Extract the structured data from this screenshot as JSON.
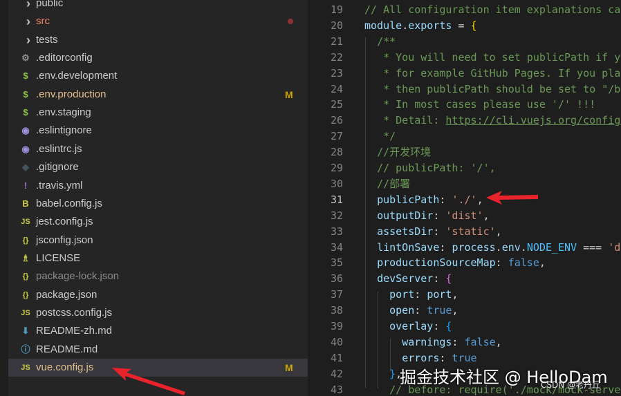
{
  "explorer": {
    "items": [
      {
        "name": "public",
        "kind": "folder",
        "icon": "chevron-right-icon"
      },
      {
        "name": "src",
        "kind": "folder",
        "icon": "chevron-right-icon",
        "decoration": "deleted-dot"
      },
      {
        "name": "tests",
        "kind": "folder",
        "icon": "chevron-right-icon"
      },
      {
        "name": ".editorconfig",
        "icon": "gear-icon"
      },
      {
        "name": ".env.development",
        "icon": "dollar-icon"
      },
      {
        "name": ".env.production",
        "icon": "dollar-icon",
        "status": "M"
      },
      {
        "name": ".env.staging",
        "icon": "dollar-icon"
      },
      {
        "name": ".eslintignore",
        "icon": "eslint-icon"
      },
      {
        "name": ".eslintrc.js",
        "icon": "eslint-icon"
      },
      {
        "name": ".gitignore",
        "icon": "git-icon"
      },
      {
        "name": ".travis.yml",
        "icon": "exclamation-icon"
      },
      {
        "name": "babel.config.js",
        "icon": "babel-icon"
      },
      {
        "name": "jest.config.js",
        "icon": "js-icon"
      },
      {
        "name": "jsconfig.json",
        "icon": "braces-icon"
      },
      {
        "name": "LICENSE",
        "icon": "license-icon"
      },
      {
        "name": "package-lock.json",
        "icon": "braces-icon",
        "dimmed": true
      },
      {
        "name": "package.json",
        "icon": "braces-icon"
      },
      {
        "name": "postcss.config.js",
        "icon": "js-icon"
      },
      {
        "name": "README-zh.md",
        "icon": "download-icon"
      },
      {
        "name": "README.md",
        "icon": "info-icon"
      },
      {
        "name": "vue.config.js",
        "icon": "js-icon",
        "status": "M",
        "selected": true
      }
    ],
    "icon_glyphs": {
      "chevron-right-icon": "›",
      "gear-icon": "⚙",
      "dollar-icon": "$",
      "eslint-icon": "◉",
      "git-icon": "◆",
      "exclamation-icon": "!",
      "babel-icon": "B",
      "js-icon": "JS",
      "braces-icon": "{}",
      "license-icon": "♗",
      "download-icon": "⬇",
      "info-icon": "ⓘ"
    }
  },
  "editor": {
    "lines": [
      {
        "n": "19",
        "text": "// All configuration item explanations can be find in https://cli.vuejs.org/config/"
      },
      {
        "n": "20",
        "text": "module.exports = {"
      },
      {
        "n": "21",
        "text": "  /**"
      },
      {
        "n": "22",
        "text": "   * You will need to set publicPath if you plan to deploy your site under a sub path,"
      },
      {
        "n": "23",
        "text": "   * for example GitHub Pages. If you plan to deploy your site to https://foo.github.io/bar/,"
      },
      {
        "n": "24",
        "text": "   * then publicPath should be set to \"/bar/\"."
      },
      {
        "n": "25",
        "text": "   * In most cases please use '/' !!!"
      },
      {
        "n": "26",
        "text": "   * Detail: https://cli.vuejs.org/config/#publicpath"
      },
      {
        "n": "27",
        "text": "   */"
      },
      {
        "n": "28",
        "text": "  //开发环境"
      },
      {
        "n": "29",
        "text": "  // publicPath: '/',"
      },
      {
        "n": "30",
        "text": "  //部署"
      },
      {
        "n": "31",
        "text": "  publicPath: './',"
      },
      {
        "n": "32",
        "text": "  outputDir: 'dist',"
      },
      {
        "n": "33",
        "text": "  assetsDir: 'static',"
      },
      {
        "n": "34",
        "text": "  lintOnSave: process.env.NODE_ENV === 'development',"
      },
      {
        "n": "35",
        "text": "  productionSourceMap: false,"
      },
      {
        "n": "36",
        "text": "  devServer: {"
      },
      {
        "n": "37",
        "text": "    port: port,"
      },
      {
        "n": "38",
        "text": "    open: true,"
      },
      {
        "n": "39",
        "text": "    overlay: {"
      },
      {
        "n": "40",
        "text": "      warnings: false,"
      },
      {
        "n": "41",
        "text": "      errors: true"
      },
      {
        "n": "42",
        "text": "    },"
      },
      {
        "n": "43",
        "text": "    // before: require('./mock/mock-server.js')"
      }
    ],
    "current_line": "31"
  },
  "watermark": {
    "main": "掘金技术社区 @ HelloDam",
    "small": "CSDN @老丹丘"
  },
  "colors": {
    "arrow": "#e8232b",
    "modified": "#e2c08d",
    "status_m": "#cca700"
  }
}
